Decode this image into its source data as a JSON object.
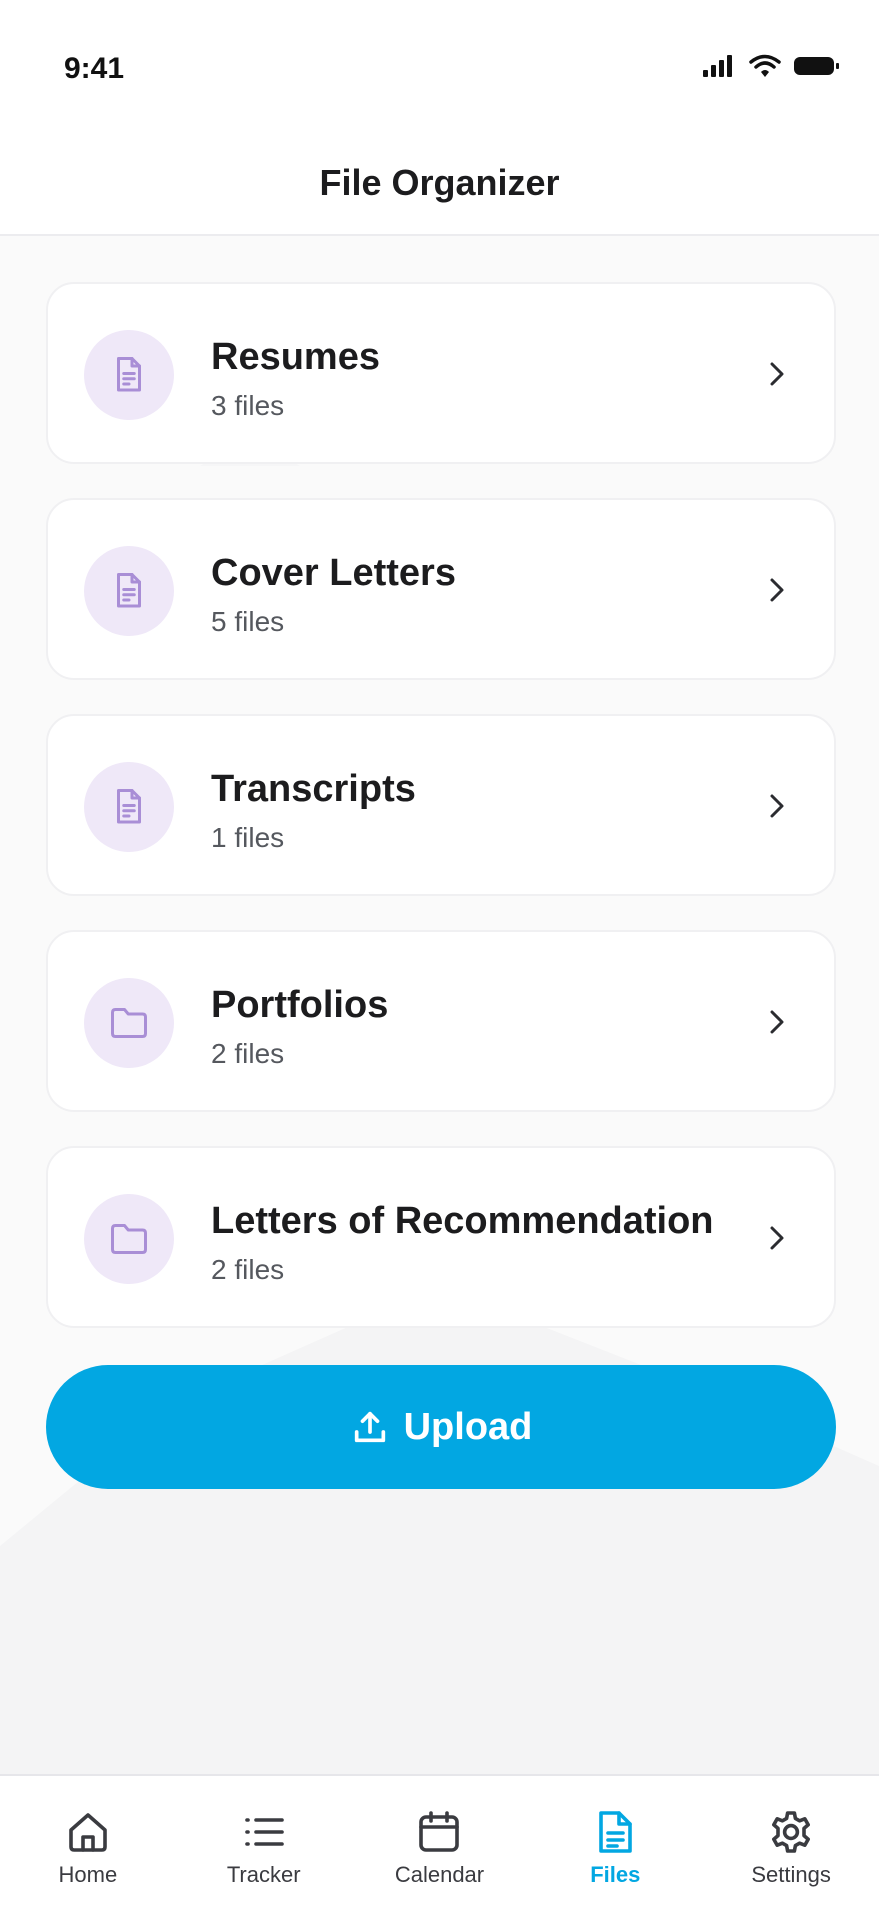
{
  "status_bar": {
    "time": "9:41"
  },
  "header": {
    "title": "File Organizer"
  },
  "folders": [
    {
      "name": "Resumes",
      "count_label": "3 files",
      "icon": "document-icon"
    },
    {
      "name": "Cover Letters",
      "count_label": "5 files",
      "icon": "document-icon"
    },
    {
      "name": "Transcripts",
      "count_label": "1 files",
      "icon": "document-icon"
    },
    {
      "name": "Portfolios",
      "count_label": "2 files",
      "icon": "folder-icon"
    },
    {
      "name": "Letters of Recommendation",
      "count_label": "2 files",
      "icon": "folder-icon"
    }
  ],
  "upload": {
    "label": "Upload",
    "icon": "upload-icon"
  },
  "tabbar": {
    "active": "Files",
    "items": [
      {
        "label": "Home",
        "icon": "home-icon"
      },
      {
        "label": "Tracker",
        "icon": "list-icon"
      },
      {
        "label": "Calendar",
        "icon": "calendar-icon"
      },
      {
        "label": "Files",
        "icon": "file-icon"
      },
      {
        "label": "Settings",
        "icon": "gear-icon"
      }
    ]
  },
  "colors": {
    "accent": "#02a7e2",
    "icon_bg": "#efe8f8",
    "icon_stroke": "#a98ed6"
  }
}
